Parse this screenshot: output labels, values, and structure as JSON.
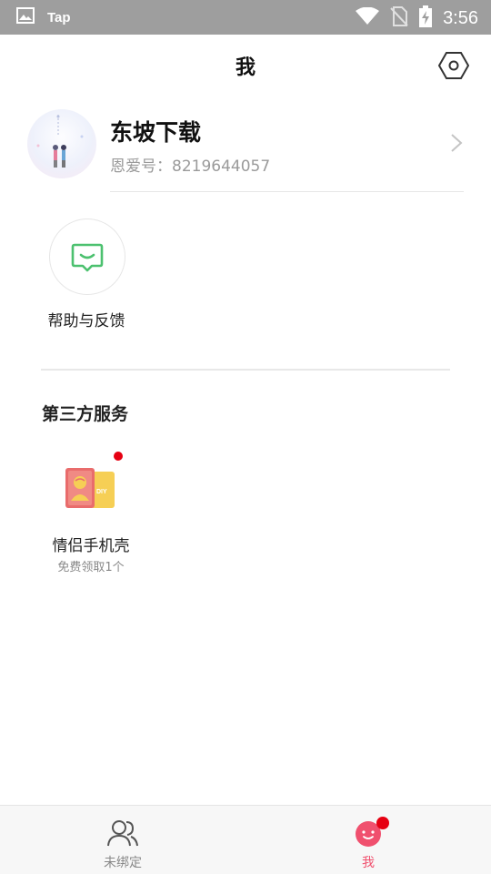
{
  "status_bar": {
    "app_label": "Tap",
    "time": "3:56",
    "icons": [
      "image-icon",
      "wifi-icon",
      "no-sim-icon",
      "battery-charging-icon"
    ]
  },
  "header": {
    "title": "我",
    "settings_icon": "hexagon-settings-icon"
  },
  "profile": {
    "name": "东坡下载",
    "id_text": "恩爱号：8219644057"
  },
  "tools": [
    {
      "label": "帮助与反馈",
      "icon": "chat-bubble-icon",
      "color": "#4cc16f"
    }
  ],
  "third_party": {
    "title": "第三方服务",
    "items": [
      {
        "label": "情侣手机壳",
        "subtitle": "免费领取1个",
        "icon": "phone-case-diy-icon",
        "has_badge": true
      }
    ]
  },
  "bottom_nav": [
    {
      "label": "未绑定",
      "icon": "people-icon",
      "active": false
    },
    {
      "label": "我",
      "icon": "smiley-face-icon",
      "active": true,
      "has_badge": true
    }
  ],
  "colors": {
    "accent": "#f0506e",
    "badge": "#e60012",
    "status_bar": "#9e9e9e",
    "help_icon": "#4cc16f"
  }
}
